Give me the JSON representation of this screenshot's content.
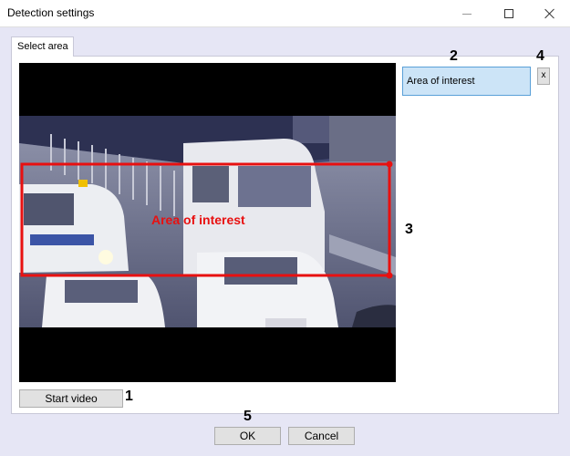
{
  "window": {
    "title": "Detection settings"
  },
  "tab": {
    "label": "Select area"
  },
  "video": {
    "overlay_label": "Area of interest"
  },
  "areas_list": {
    "items": [
      {
        "label": "Area of interest",
        "selected": true
      }
    ],
    "delete_label": "x"
  },
  "buttons": {
    "start_video": "Start video",
    "ok": "OK",
    "cancel": "Cancel"
  },
  "callouts": [
    "1",
    "2",
    "3",
    "4",
    "5"
  ],
  "colors": {
    "area_outline": "#e81010",
    "selected_item_bg": "#cce4f7",
    "dialog_bg": "#e6e6f5"
  }
}
